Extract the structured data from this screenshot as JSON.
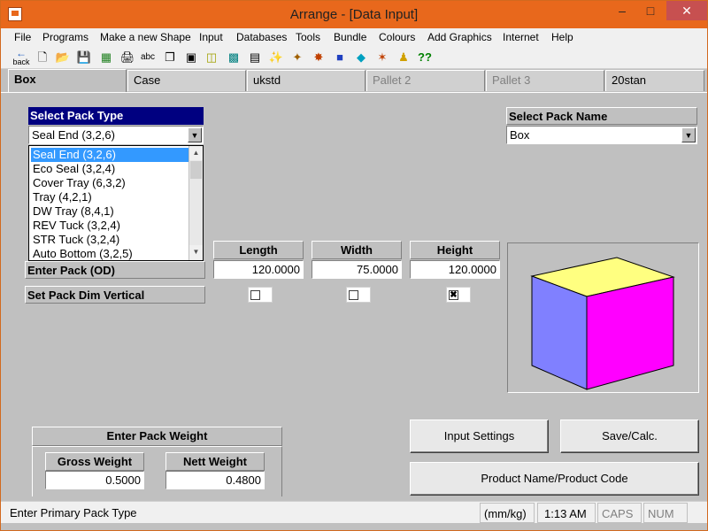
{
  "window": {
    "title": "Arrange - [Data Input]"
  },
  "titlebar_buttons": {
    "minimize": "–",
    "maximize": "□",
    "close": "✕"
  },
  "menu": [
    "File",
    "Programs",
    "Make a new Shape",
    "Input",
    "Databases",
    "Tools",
    "Bundle",
    "Colours",
    "Add Graphics",
    "Internet",
    "Help"
  ],
  "toolbar": {
    "back_label": "back",
    "icons": [
      "new-file-icon",
      "open-folder-icon",
      "save-icon",
      "calculator-icon",
      "print-icon",
      "abc-text-icon",
      "copy-icon",
      "page-icon",
      "flowchart-icon",
      "box-icon",
      "arrange-icon",
      "stack-icon",
      "wand-icon",
      "cube-icon",
      "yellow-cube-icon",
      "people-icon",
      "person-icon",
      "help-icon"
    ]
  },
  "tabs": [
    {
      "label": "Box",
      "active": true,
      "disabled": false
    },
    {
      "label": "Case",
      "active": false,
      "disabled": false
    },
    {
      "label": "ukstd",
      "active": false,
      "disabled": false
    },
    {
      "label": "Pallet 2",
      "active": false,
      "disabled": true
    },
    {
      "label": "Pallet 3",
      "active": false,
      "disabled": true
    },
    {
      "label": "20stan",
      "active": false,
      "disabled": false
    }
  ],
  "pack_type": {
    "label": "Select Pack Type",
    "selected": "Seal End (3,2,6)",
    "options": [
      "Seal End (3,2,6)",
      "Eco Seal (3,2,4)",
      "Cover Tray (6,3,2)",
      "Tray (4,2,1)",
      "DW Tray (8,4,1)",
      "REV Tuck (3,2,4)",
      "STR Tuck (3,2,4)",
      "Auto Bottom (3,2,5)"
    ]
  },
  "pack_name": {
    "label": "Select Pack Name",
    "selected": "Box"
  },
  "dimensions": {
    "row_label": "Enter Pack (OD)",
    "vertical_label": "Set Pack Dim Vertical",
    "length": {
      "header": "Length",
      "value": "120.0000",
      "vertical": ""
    },
    "width": {
      "header": "Width",
      "value": "75.0000",
      "vertical": ""
    },
    "height": {
      "header": "Height",
      "value": "120.0000",
      "vertical": "✖"
    }
  },
  "weight": {
    "title": "Enter Pack Weight",
    "gross": {
      "label": "Gross Weight",
      "value": "0.5000"
    },
    "nett": {
      "label": "Nett Weight",
      "value": "0.4800"
    }
  },
  "buttons": {
    "input_settings": "Input Settings",
    "save_calc": "Save/Calc.",
    "product_name": "Product Name/Product Code"
  },
  "status": {
    "message": "Enter Primary Pack Type",
    "units": "(mm/kg)",
    "time": "1:13 AM",
    "caps": "CAPS",
    "num": "NUM"
  },
  "colors": {
    "titlebar": "#e8681c",
    "cube_top": "#ffff80",
    "cube_left": "#8080ff",
    "cube_right": "#ff00ff",
    "selection": "#3399ff",
    "pack_type_header": "#000080"
  }
}
